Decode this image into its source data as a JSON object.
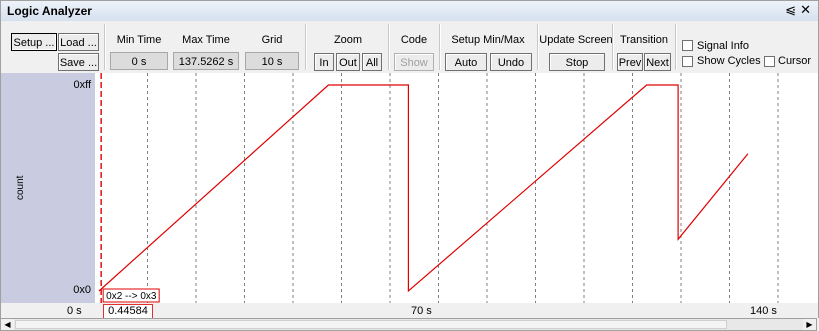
{
  "window": {
    "title": "Logic Analyzer",
    "pin_glyph": "⩿",
    "close_glyph": "✕"
  },
  "toolbar": {
    "setup_label": "Setup ...",
    "load_label": "Load ...",
    "save_label": "Save ...",
    "min_time_label": "Min Time",
    "min_time_value": "0 s",
    "max_time_label": "Max Time",
    "max_time_value": "137.5262 s",
    "grid_label": "Grid",
    "grid_value": "10 s",
    "zoom_label": "Zoom",
    "zoom_in": "In",
    "zoom_out": "Out",
    "zoom_all": "All",
    "code_label": "Code",
    "code_show": "Show",
    "setup_minmax_label": "Setup Min/Max",
    "auto_label": "Auto",
    "undo_label": "Undo",
    "update_screen_label": "Update Screen",
    "stop_label": "Stop",
    "transition_label": "Transition",
    "prev_label": "Prev",
    "next_label": "Next",
    "signal_info_label": "Signal Info",
    "show_cycles_label": "Show Cycles",
    "cursor_label": "Cursor"
  },
  "signal": {
    "name": "count",
    "y_max_label": "0xff",
    "y_min_label": "0x0"
  },
  "cursor": {
    "transition_label": "0x2 --> 0x3",
    "time_label": "0.44584 s"
  },
  "time_axis": {
    "left_label": "0 s",
    "mid_label": "70 s",
    "right_label": "140 s"
  },
  "chart_data": {
    "type": "line",
    "title": "",
    "xlabel": "",
    "ylabel": "count",
    "xlim": [
      0,
      137.5262
    ],
    "ylim": [
      0,
      255
    ],
    "grid": true,
    "grid_step": 10,
    "colors": {
      "trace": "#e00000",
      "cursor": "#e00000",
      "grid": "#808080"
    },
    "series": [
      {
        "name": "count",
        "x": [
          0,
          47.3,
          47.3,
          63.8,
          63.8,
          112.9,
          112.9,
          119.4,
          119.4,
          133.8
        ],
        "y": [
          0,
          255,
          255,
          255,
          0,
          255,
          255,
          255,
          64,
          170
        ]
      }
    ],
    "cursor_x": 0.44584,
    "x_ticks": [
      0,
      70,
      140
    ]
  }
}
